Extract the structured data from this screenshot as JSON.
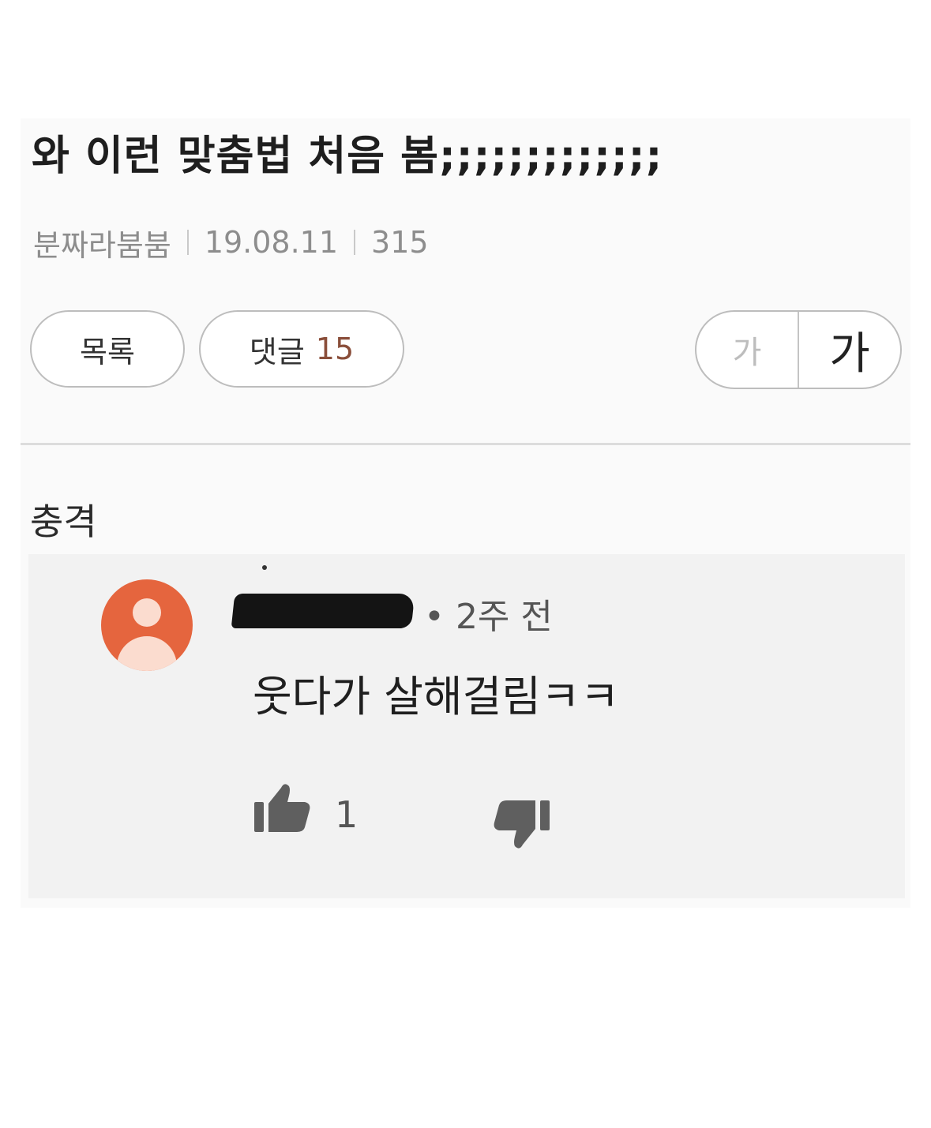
{
  "post": {
    "title": "와 이런 맞춤법 처음 봄;;;;;;;;;;;;;",
    "author": "분짜라붐붐",
    "date": "19.08.11",
    "views": "315"
  },
  "actions": {
    "list_label": "목록",
    "comment_label": "댓글",
    "comment_count": "15",
    "font_small_label": "가",
    "font_large_label": "가"
  },
  "content": {
    "text": "충격"
  },
  "comment": {
    "time_ago": "• 2주 전",
    "text": "웃다가 살해걸림ㅋㅋ",
    "like_count": "1"
  },
  "colors": {
    "avatar": "#e5653e",
    "comment_count": "#8a4e3a"
  },
  "icons": [
    "avatar-icon",
    "thumbs-up-icon",
    "thumbs-down-icon"
  ]
}
